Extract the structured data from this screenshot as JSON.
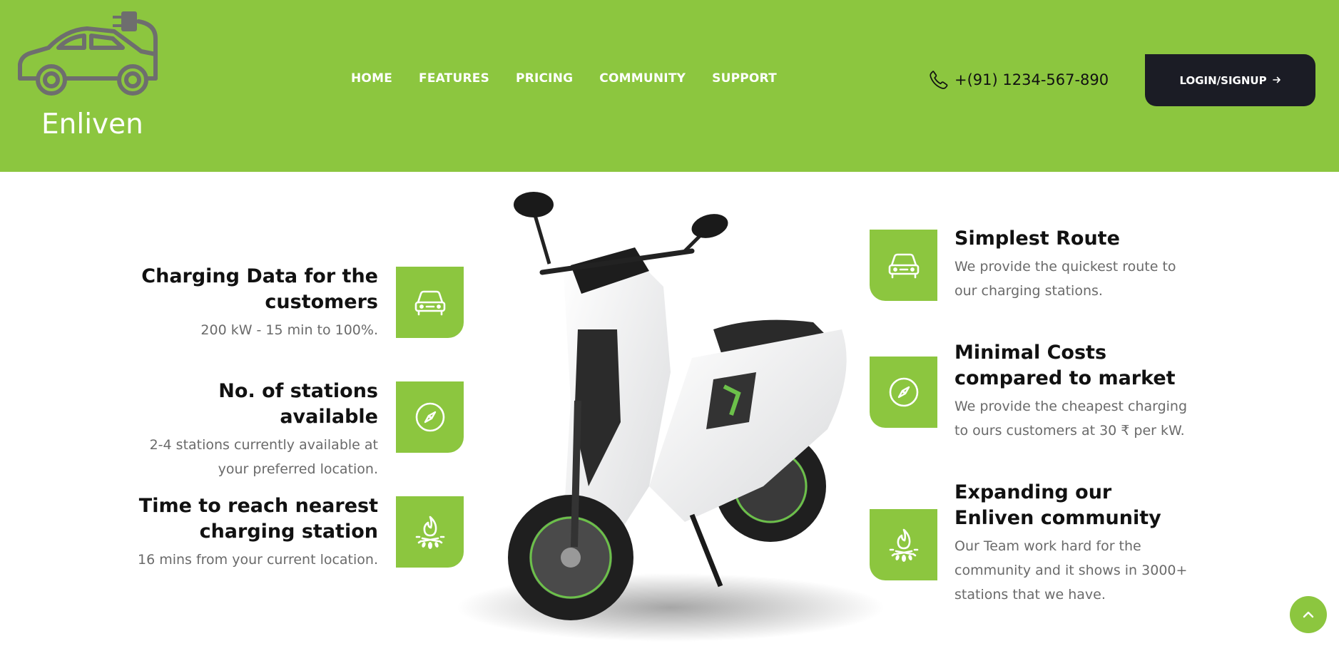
{
  "brand": {
    "name": "Enliven"
  },
  "nav": {
    "items": [
      {
        "label": "HOME"
      },
      {
        "label": "FEATURES"
      },
      {
        "label": "PRICING"
      },
      {
        "label": "COMMUNITY"
      },
      {
        "label": "SUPPORT"
      }
    ]
  },
  "contact": {
    "phone": "+(91) 1234-567-890",
    "icon": "phone-icon"
  },
  "auth": {
    "login_label": "LOGIN/SIGNUP",
    "icon": "arrow-right-icon"
  },
  "features_left": [
    {
      "title": "Charging Data for the customers",
      "desc": "200 kW - 15 min to 100%.",
      "icon": "car-icon"
    },
    {
      "title": "No. of stations available",
      "desc": "2-4 stations currently available at your preferred location.",
      "icon": "compass-icon"
    },
    {
      "title": "Time to reach nearest charging station",
      "desc": "16 mins from your current location.",
      "icon": "campfire-icon"
    }
  ],
  "features_right": [
    {
      "title": "Simplest Route",
      "desc": "We provide the quickest route to our charging stations.",
      "icon": "car-icon"
    },
    {
      "title": "Minimal Costs compared to market",
      "desc": "We provide the cheapest charging to ours customers at 30 ₹ per kW.",
      "icon": "compass-icon"
    },
    {
      "title": "Expanding our Enliven community",
      "desc": "Our Team work hard for the community and it shows in 3000+ stations that we have.",
      "icon": "campfire-icon"
    }
  ],
  "colors": {
    "accent": "#8cc63f",
    "dark": "#1b1c25",
    "text_muted": "#6a6a6a"
  },
  "scroll_top": {
    "icon": "chevron-up-icon"
  }
}
